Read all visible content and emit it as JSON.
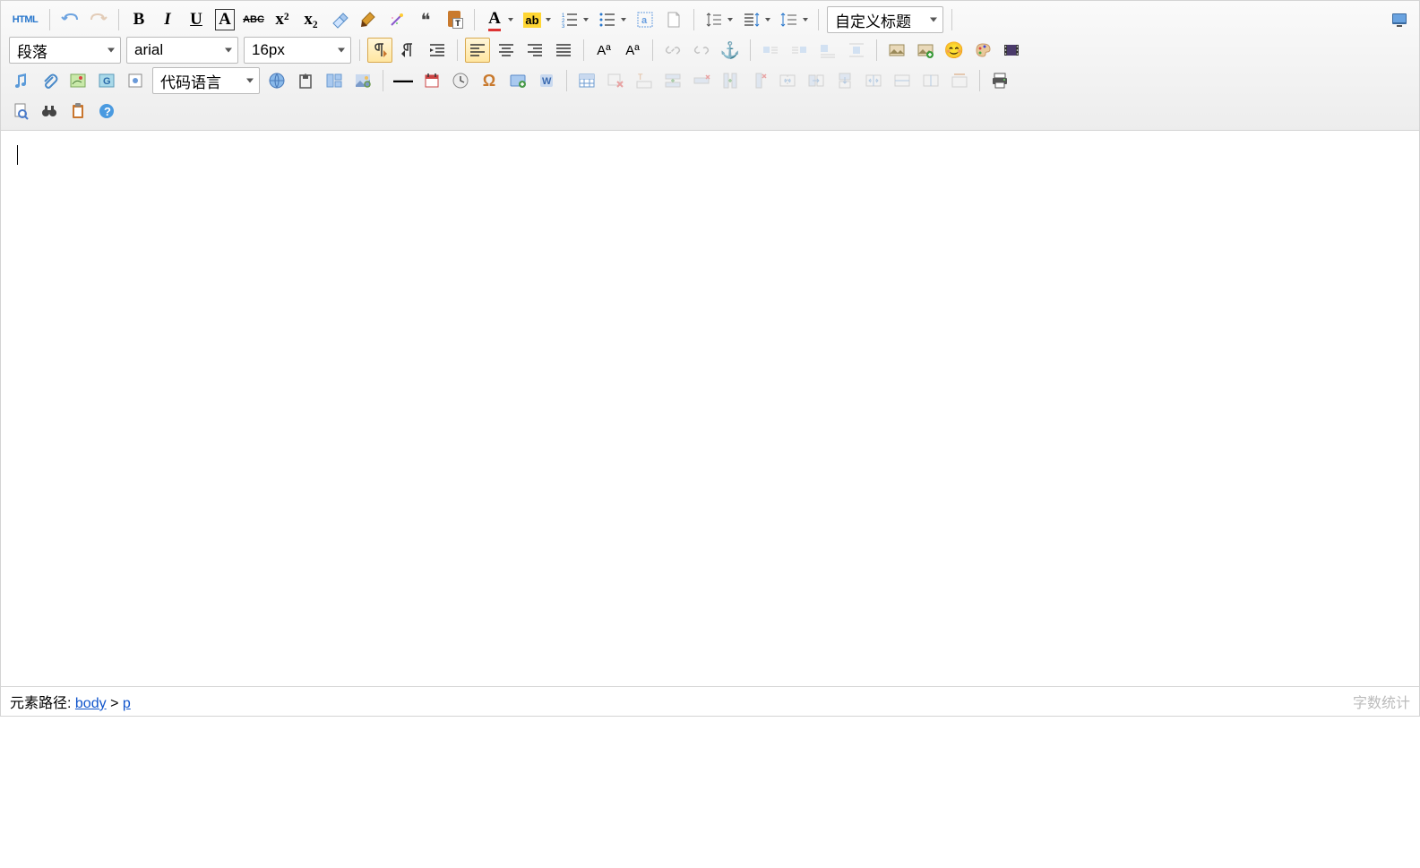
{
  "toolbar": {
    "html_label": "HTML",
    "paragraph_format": "段落",
    "font_family": "arial",
    "font_size": "16px",
    "code_language": "代码语言",
    "custom_heading": "自定义标题",
    "bold_glyph": "B",
    "italic_glyph": "I",
    "underline_glyph": "U",
    "background_glyph": "A",
    "strike_glyph": "ABC",
    "super_glyph": "x²",
    "sub_glyph": "x₂",
    "quote_glyph": "❝",
    "plaintext_glyph": "T",
    "font_a": "A",
    "highlight_ab": "ab",
    "caseupper": "Aª",
    "caselower": "Aª",
    "omega": "Ω",
    "anchor_glyph": "⚓",
    "emoji_face": "😊",
    "hr_glyph": "—"
  },
  "statusbar": {
    "path_label": "元素路径",
    "path_body": "body",
    "path_sep": ">",
    "path_p": "p",
    "word_count_label": "字数统计"
  }
}
